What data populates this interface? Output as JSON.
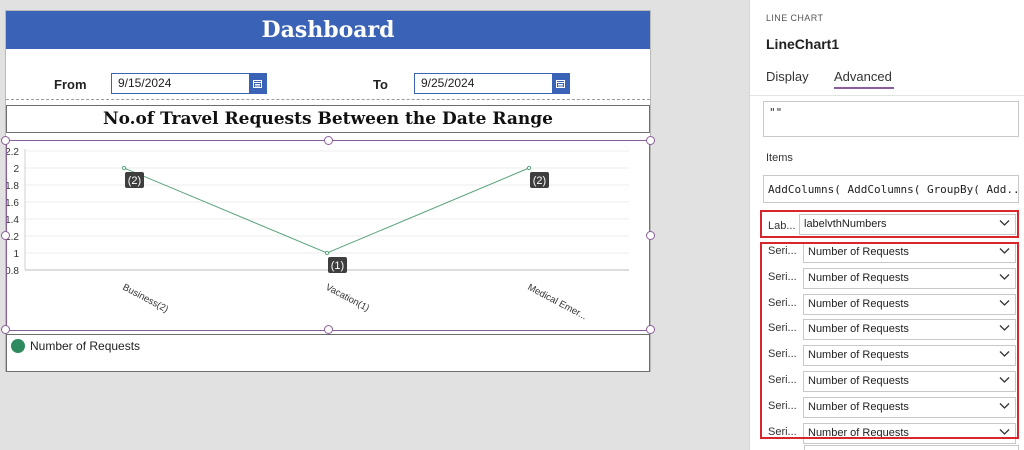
{
  "app": {
    "header_title": "Dashboard",
    "from_label": "From",
    "from_value": "9/15/2024",
    "to_label": "To",
    "to_value": "9/25/2024",
    "subtitle": "No.of Travel Requests Between the Date Range"
  },
  "chart_data": {
    "type": "line",
    "categories": [
      "Business(2)",
      "Vacation(1)",
      "Medical Emer..."
    ],
    "series": [
      {
        "name": "Number of Requests",
        "values": [
          2,
          1,
          2
        ]
      }
    ],
    "data_labels": [
      "(2)",
      "(1)",
      "(2)"
    ],
    "y_ticks": [
      "0.8",
      "1",
      "1.2",
      "1.4",
      "1.6",
      "1.8",
      "2",
      "2.2"
    ],
    "ylim": [
      0.8,
      2.2
    ],
    "grid": true,
    "legend_position": "bottom",
    "line_color": "#5aa47c",
    "legend_color": "#2e8b5f"
  },
  "legend": {
    "label": "Number of Requests"
  },
  "panel": {
    "type_label": "LINE CHART",
    "control_name": "LineChart1",
    "tabs": [
      "Display",
      "Advanced"
    ],
    "active_tab": "Advanced",
    "top_box_value": "\"\"",
    "items_label": "Items",
    "items_formula": "AddColumns( AddColumns( GroupBy( Add...",
    "labels_row": {
      "label": "Lab...",
      "value": "labelvthNumbers"
    },
    "series_rows": [
      {
        "label": "Seri...",
        "value": "Number of Requests"
      },
      {
        "label": "Seri...",
        "value": "Number of Requests"
      },
      {
        "label": "Seri...",
        "value": "Number of Requests"
      },
      {
        "label": "Seri...",
        "value": "Number of Requests"
      },
      {
        "label": "Seri...",
        "value": "Number of Requests"
      },
      {
        "label": "Seri...",
        "value": "Number of Requests"
      },
      {
        "label": "Seri...",
        "value": "Number of Requests"
      },
      {
        "label": "Seri...",
        "value": "Number of Requests"
      }
    ],
    "accent_color": "#8a5e9a",
    "highlight_color": "#d9262c"
  }
}
